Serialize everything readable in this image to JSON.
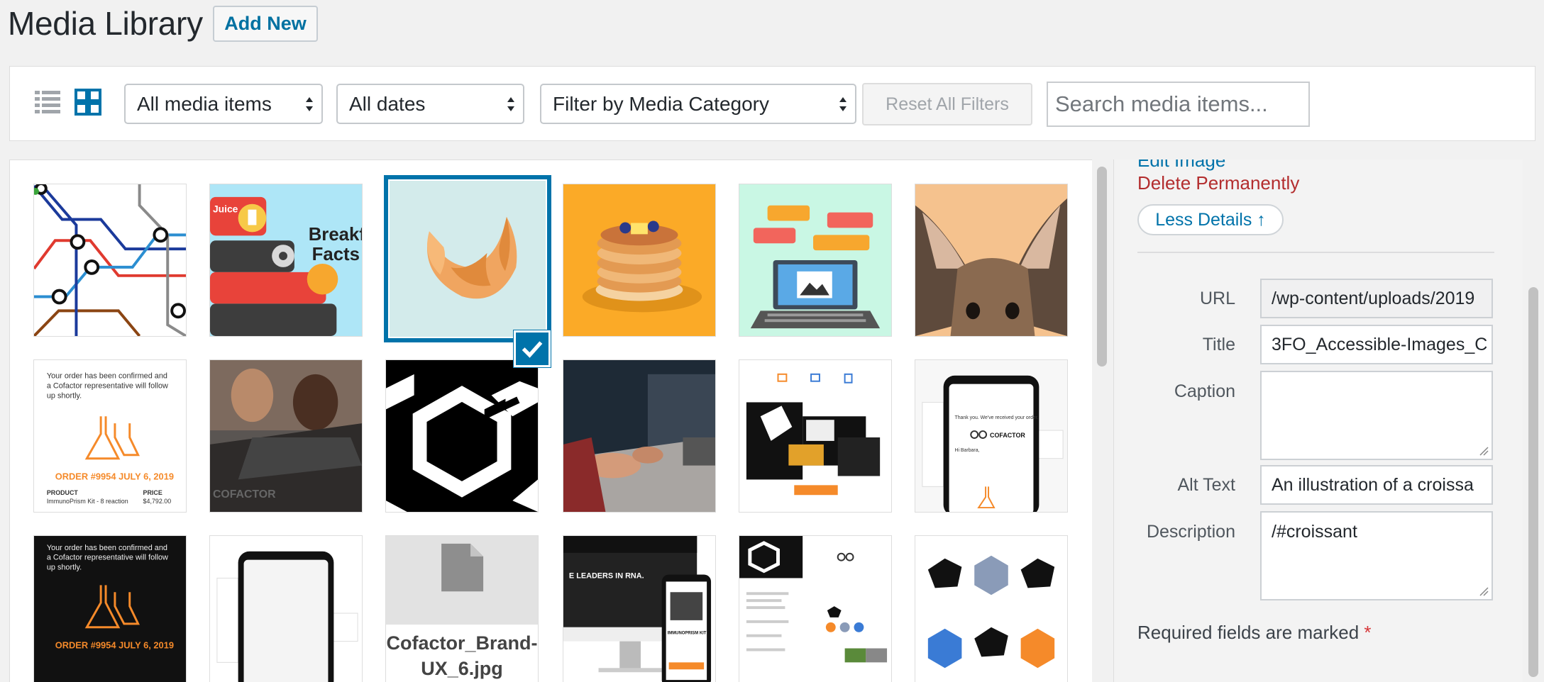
{
  "header": {
    "title": "Media Library",
    "add_new": "Add New"
  },
  "toolbar": {
    "filters": [
      {
        "name": "media-type-select",
        "value": "All media items"
      },
      {
        "name": "date-select",
        "value": "All dates"
      },
      {
        "name": "category-select",
        "value": "Filter by Media Category"
      }
    ],
    "reset": "Reset All Filters",
    "search_placeholder": "Search media items..."
  },
  "grid": {
    "file_placeholder_name": "Cofactor_Brand-UX_6.jpg",
    "selected_index": 2
  },
  "details": {
    "edit_image": "Edit Image",
    "delete": "Delete Permanently",
    "less_details": "Less Details ↑",
    "fields": {
      "url_label": "URL",
      "url_value": "/wp-content/uploads/2019",
      "title_label": "Title",
      "title_value": "3FO_Accessible-Images_C",
      "caption_label": "Caption",
      "caption_value": "",
      "alt_label": "Alt Text",
      "alt_value": "An illustration of a croissa",
      "description_label": "Description",
      "description_value": "/#croissant"
    },
    "required_note": "Required fields are marked",
    "required_star": "*"
  },
  "thumb_text": {
    "breakfast_line1": "Breakf",
    "breakfast_line2": "Facts",
    "juice": "Juice",
    "order_confirm_1": "Your order has been confirmed and",
    "order_confirm_2": "a Cofactor representative will follow",
    "order_confirm_3": "up shortly.",
    "order_number": "ORDER #9954  JULY 6, 2019",
    "order_number_dark": "ORDER #9954  JULY 6, 2019",
    "product_label": "PRODUCT",
    "price_label": "PRICE",
    "product_value": "ImmunoPrism Kit - 8 reaction",
    "price_value": "$4,792.00",
    "cofactor": "COFACTOR",
    "thanks": "Thank you. We've received your order.",
    "hi": "Hi Barbara,",
    "leaders": "E LEADERS IN RNA.",
    "immuno_kit": "IMMUNOPRISM KIT"
  },
  "colors": {
    "accent": "#0073aa",
    "danger": "#b32d2e",
    "orange": "#f7a72e",
    "mint": "#c9f7e4"
  }
}
